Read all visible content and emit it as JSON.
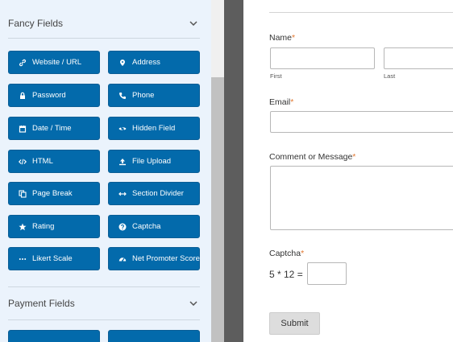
{
  "sidebar": {
    "fancy_fields": {
      "title": "Fancy Fields",
      "buttons": [
        {
          "label": "Website / URL",
          "icon": "link-icon"
        },
        {
          "label": "Address",
          "icon": "map-marker-icon"
        },
        {
          "label": "Password",
          "icon": "lock-icon"
        },
        {
          "label": "Phone",
          "icon": "phone-icon"
        },
        {
          "label": "Date / Time",
          "icon": "calendar-icon"
        },
        {
          "label": "Hidden Field",
          "icon": "eye-slash-icon"
        },
        {
          "label": "HTML",
          "icon": "code-icon"
        },
        {
          "label": "File Upload",
          "icon": "upload-icon"
        },
        {
          "label": "Page Break",
          "icon": "copy-icon"
        },
        {
          "label": "Section Divider",
          "icon": "arrows-h-icon"
        },
        {
          "label": "Rating",
          "icon": "star-icon"
        },
        {
          "label": "Captcha",
          "icon": "question-circle-icon"
        },
        {
          "label": "Likert Scale",
          "icon": "ellipsis-icon"
        },
        {
          "label": "Net Promoter Score",
          "icon": "tachometer-icon"
        }
      ]
    },
    "payment_fields": {
      "title": "Payment Fields"
    }
  },
  "form": {
    "name_label": "Name",
    "name_first_sub": "First",
    "name_last_sub": "Last",
    "email_label": "Email",
    "comment_label": "Comment or Message",
    "captcha_label": "Captcha",
    "captcha_question": "5 * 12 =",
    "required_marker": "*",
    "submit_label": "Submit"
  },
  "colors": {
    "button_bg": "#036aab",
    "panel_bg": "#ebf3fc",
    "required": "#e27730"
  }
}
